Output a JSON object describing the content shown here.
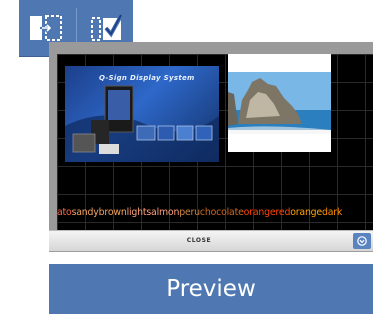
{
  "toolbar": {
    "icons": [
      "move-into-frame-icon",
      "checkbox-check-icon"
    ],
    "accent": "#4f78b2"
  },
  "preview": {
    "slide_left_title": "Q-Sign Display System",
    "ticker_words": [
      {
        "text": "ato",
        "color": "#ff6347"
      },
      {
        "text": "sandybrown",
        "color": "#f4a460"
      },
      {
        "text": "lightsalmon",
        "color": "#ffa07a"
      },
      {
        "text": "peru",
        "color": "#cd853f"
      },
      {
        "text": "chocolate",
        "color": "#d2691e"
      },
      {
        "text": "orangered",
        "color": "#ff4500"
      },
      {
        "text": "orange",
        "color": "#ffa500"
      },
      {
        "text": "dark",
        "color": "#ff8c00"
      }
    ]
  },
  "closebar": {
    "close_label": "CLOSE"
  },
  "preview_button": {
    "label": "Preview"
  }
}
